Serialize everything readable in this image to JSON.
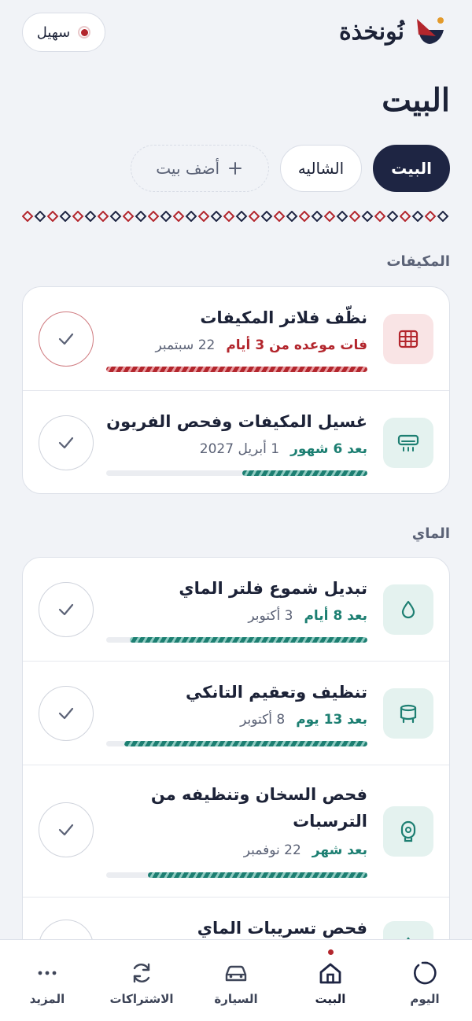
{
  "header": {
    "brand_name": "نُونخذة",
    "user_chip": "سهيل",
    "page_title": "البيت"
  },
  "tabs": [
    {
      "label": "البيت",
      "active": true
    },
    {
      "label": "الشاليه",
      "active": false
    },
    {
      "label": "أضف بيت",
      "add": true
    }
  ],
  "sections": [
    {
      "label": "المكيفات",
      "tasks": [
        {
          "title": "نظّف فلاتر المكيفات",
          "status": "فات موعده من 3 أيام",
          "date": "22 سبتمبر",
          "tone": "red",
          "progress": 1.0,
          "icon": "grid-filter-icon"
        },
        {
          "title": "غسيل المكيفات وفحص الفريون",
          "status": "بعد 6 شهور",
          "date": "1 أبريل 2027",
          "tone": "teal",
          "progress": 0.48,
          "icon": "air-conditioner-icon"
        }
      ]
    },
    {
      "label": "الماي",
      "tasks": [
        {
          "title": "تبديل شموع فلتر الماي",
          "status": "بعد 8 أيام",
          "date": "3 أكتوبر",
          "tone": "teal",
          "progress": 0.91,
          "icon": "water-drop-icon"
        },
        {
          "title": "تنظيف وتعقيم التانكي",
          "status": "بعد 13 يوم",
          "date": "8 أكتوبر",
          "tone": "teal",
          "progress": 0.93,
          "icon": "water-tank-icon"
        },
        {
          "title": "فحص السخان وتنظيفه من الترسبات",
          "status": "بعد شهر",
          "date": "22 نوفمبر",
          "tone": "teal",
          "progress": 0.84,
          "icon": "water-heater-icon"
        },
        {
          "title": "فحص تسريبات الماي",
          "status": "",
          "date": "",
          "tone": "teal",
          "progress": 0,
          "icon": "leak-check-icon"
        }
      ]
    }
  ],
  "bottom_nav": [
    {
      "label": "اليوم",
      "icon": "today-circle-icon"
    },
    {
      "label": "البيت",
      "icon": "home-icon",
      "active": true
    },
    {
      "label": "السيارة",
      "icon": "car-icon"
    },
    {
      "label": "الاشتراكات",
      "icon": "refresh-icon"
    },
    {
      "label": "المزيد",
      "icon": "more-dots-icon"
    }
  ],
  "colors": {
    "accent": "#1e2543",
    "overdue": "#b3262d",
    "ok": "#1d7f72",
    "background": "#f1f3f7"
  }
}
